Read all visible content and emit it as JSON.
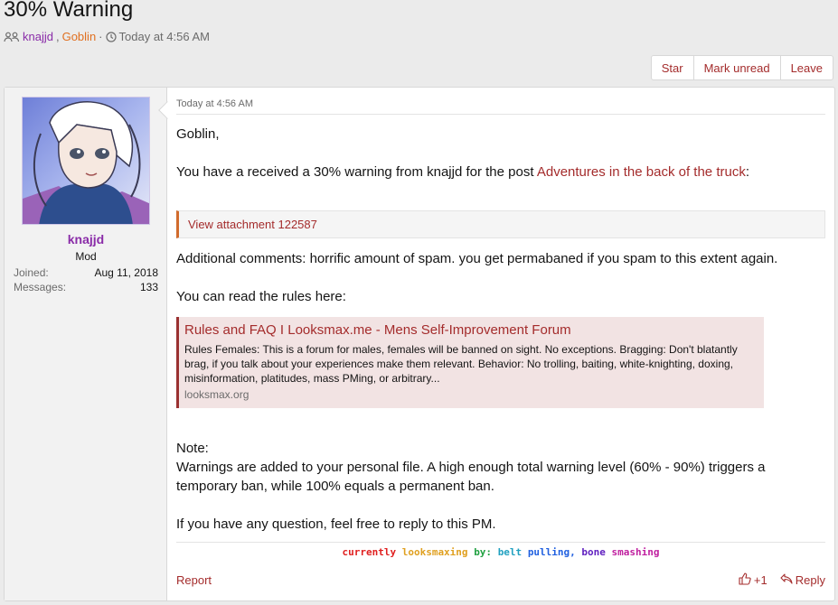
{
  "thread": {
    "title": "30% Warning",
    "participant_1": "knajjd",
    "participant_2": "Goblin",
    "separator": "·",
    "timestamp": "Today at 4:56 AM"
  },
  "actions": {
    "star": "Star",
    "mark_unread": "Mark unread",
    "leave": "Leave"
  },
  "author": {
    "name": "knajjd",
    "title": "Mod",
    "joined_label": "Joined:",
    "joined_value": "Aug 11, 2018",
    "messages_label": "Messages:",
    "messages_value": "133"
  },
  "message": {
    "date": "Today at 4:56 AM",
    "greeting": "Goblin,",
    "warn_text": "You have a received a 30% warning from knajjd for the post ",
    "post_link": "Adventures in the back of the truck",
    "colon": ":",
    "attachment": "View attachment 122587",
    "additional": "Additional comments: horrific amount of spam. you get permabaned if you spam to this extent again.",
    "rules_intro": "You can read the rules here:",
    "note_label": "Note:",
    "note_body": "Warnings are added to your personal file. A high enough total warning level (60% - 90%) triggers a temporary ban, while 100% equals a permanent ban.",
    "question": "If you have any question, feel free to reply to this PM."
  },
  "unfurl": {
    "title": "Rules and FAQ I Looksmax.me - Mens Self-Improvement Forum",
    "description": "Rules Females: This is a forum for males, females will be banned on sight. No exceptions. Bragging: Don't blatantly brag, if you talk about your experiences make them relevant. Behavior: No trolling, baiting, white-knighting, doxing, misinformation, platitudes, mass PMing, or arbitrary...",
    "site": "looksmax.org"
  },
  "signature": {
    "words": [
      {
        "text": "currently",
        "color": "#e02020"
      },
      {
        "text": "looksmaxing",
        "color": "#e0a020"
      },
      {
        "text": "by:",
        "color": "#20a040"
      },
      {
        "text": "belt",
        "color": "#20a0c0"
      },
      {
        "text": "pulling,",
        "color": "#2060e0"
      },
      {
        "text": "bone",
        "color": "#6020c0"
      },
      {
        "text": "smashing",
        "color": "#c020a0"
      }
    ]
  },
  "footer": {
    "report": "Report",
    "like_count": "+1",
    "reply": "Reply"
  },
  "colors": {
    "link": "#a42c2c",
    "username": "#8a2ca8",
    "participant_2": "#e07020"
  }
}
